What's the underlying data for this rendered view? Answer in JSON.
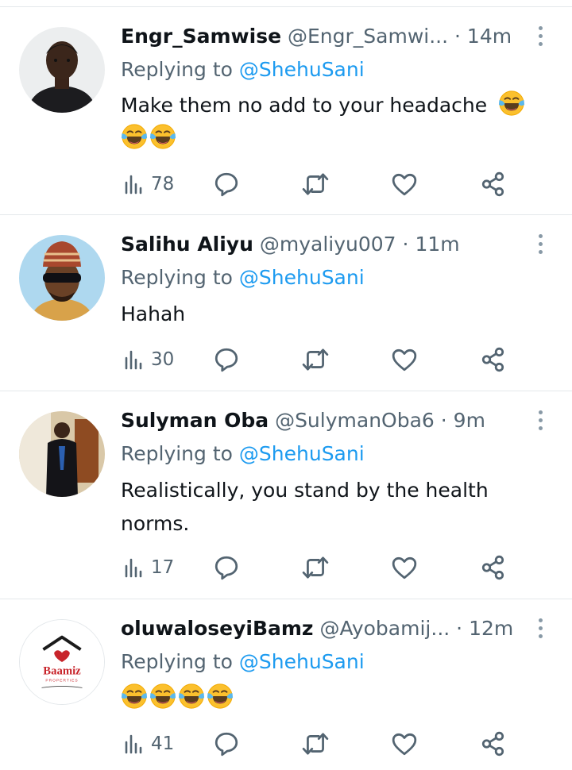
{
  "reply_prefix": "Replying to",
  "colors": {
    "accent": "#1d9bf0",
    "secondary": "#536471",
    "divider": "#e4e8eb"
  },
  "tweets": [
    {
      "name": "Engr_Samwise",
      "handle": "@Engr_Samwi...",
      "time": "14m",
      "replying_to": "@ShehuSani",
      "text": "Make them no add to your headache",
      "emojis": [
        "face-with-tears-of-joy",
        "face-with-tears-of-joy",
        "face-with-tears-of-joy"
      ],
      "views": "78"
    },
    {
      "name": "Salihu Aliyu",
      "handle": "@myaliyu007",
      "time": "11m",
      "replying_to": "@ShehuSani",
      "text": "Hahah",
      "views": "30"
    },
    {
      "name": "Sulyman Oba",
      "handle": "@SulymanOba6",
      "time": "9m",
      "replying_to": "@ShehuSani",
      "text": "Realistically, you stand by the health norms.",
      "views": "17"
    },
    {
      "name": "oluwaloseyiBamz",
      "handle": "@Ayobamij...",
      "time": "12m",
      "replying_to": "@ShehuSani",
      "text": "",
      "emojis": [
        "face-with-tears-of-joy",
        "face-with-tears-of-joy",
        "face-with-tears-of-joy",
        "face-with-tears-of-joy"
      ],
      "views": "41",
      "avatar_logo": {
        "brand": "Baamiz",
        "sub": "PROPERTIES"
      }
    }
  ],
  "icons": [
    "views-icon",
    "reply-icon",
    "retweet-icon",
    "like-icon",
    "share-icon",
    "more-icon"
  ]
}
